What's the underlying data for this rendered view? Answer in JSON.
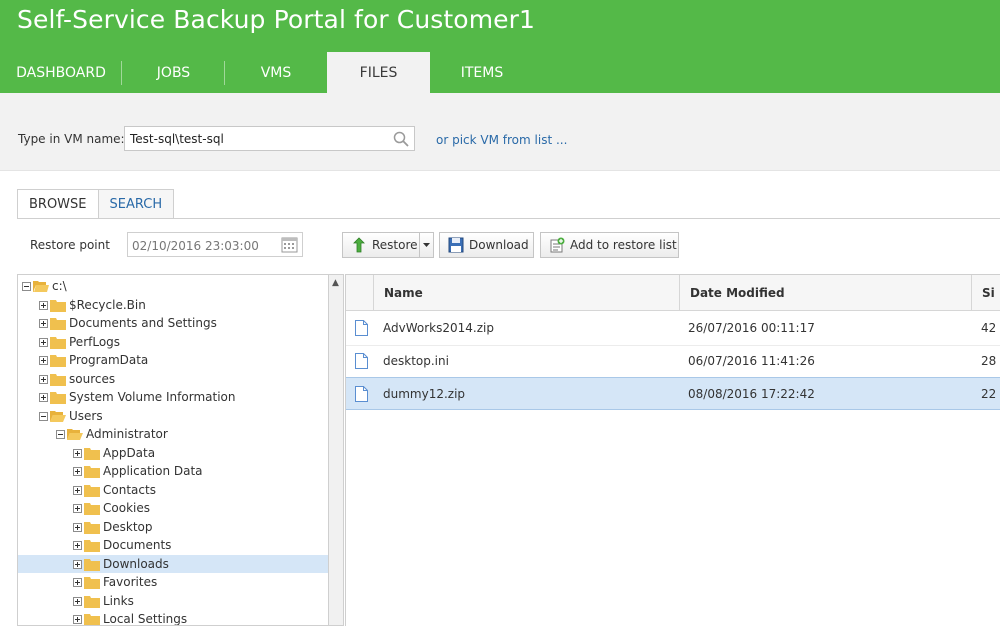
{
  "app": {
    "title": "Self-Service Backup Portal for Customer1"
  },
  "nav": {
    "tabs": [
      "DASHBOARD",
      "JOBS",
      "VMS",
      "FILES",
      "ITEMS"
    ],
    "active": "FILES"
  },
  "vm_bar": {
    "label": "Type in VM name:",
    "value": "Test-sql\\test-sql",
    "pick_link": "or pick VM from list ..."
  },
  "browse": {
    "tabs": [
      "BROWSE",
      "SEARCH"
    ],
    "restore_point_label": "Restore point",
    "restore_point_value": "02/10/2016 23:03:00"
  },
  "toolbar": {
    "restore": "Restore",
    "download": "Download",
    "add_to_list": "Add to restore list"
  },
  "tree": {
    "items": [
      {
        "label": "c:\\",
        "level": 0,
        "expanded": true
      },
      {
        "label": "$Recycle.Bin",
        "level": 1,
        "expanded": false
      },
      {
        "label": "Documents and Settings",
        "level": 1,
        "expanded": false
      },
      {
        "label": "PerfLogs",
        "level": 1,
        "expanded": false
      },
      {
        "label": "ProgramData",
        "level": 1,
        "expanded": false
      },
      {
        "label": "sources",
        "level": 1,
        "expanded": false
      },
      {
        "label": "System Volume Information",
        "level": 1,
        "expanded": false
      },
      {
        "label": "Users",
        "level": 1,
        "expanded": true
      },
      {
        "label": "Administrator",
        "level": 2,
        "expanded": true
      },
      {
        "label": "AppData",
        "level": 3,
        "expanded": false
      },
      {
        "label": "Application Data",
        "level": 3,
        "expanded": false
      },
      {
        "label": "Contacts",
        "level": 3,
        "expanded": false
      },
      {
        "label": "Cookies",
        "level": 3,
        "expanded": false
      },
      {
        "label": "Desktop",
        "level": 3,
        "expanded": false
      },
      {
        "label": "Documents",
        "level": 3,
        "expanded": false
      },
      {
        "label": "Downloads",
        "level": 3,
        "expanded": false,
        "selected": true
      },
      {
        "label": "Favorites",
        "level": 3,
        "expanded": false
      },
      {
        "label": "Links",
        "level": 3,
        "expanded": false
      },
      {
        "label": "Local Settings",
        "level": 3,
        "expanded": false
      }
    ]
  },
  "grid": {
    "columns": [
      "Name",
      "Date Modified",
      "Si"
    ],
    "rows": [
      {
        "name": "AdvWorks2014.zip",
        "date": "26/07/2016 00:11:17",
        "size": "42"
      },
      {
        "name": "desktop.ini",
        "date": "06/07/2016 11:41:26",
        "size": "28"
      },
      {
        "name": "dummy12.zip",
        "date": "08/08/2016 17:22:42",
        "size": "22",
        "selected": true
      }
    ]
  },
  "colors": {
    "header_green": "#54b948",
    "link_blue": "#2a6aa8",
    "selection": "#d5e6f7"
  },
  "icons": [
    "search-icon",
    "calendar-icon",
    "restore-icon",
    "download-icon",
    "add-to-list-icon",
    "folder-icon",
    "file-icon"
  ]
}
